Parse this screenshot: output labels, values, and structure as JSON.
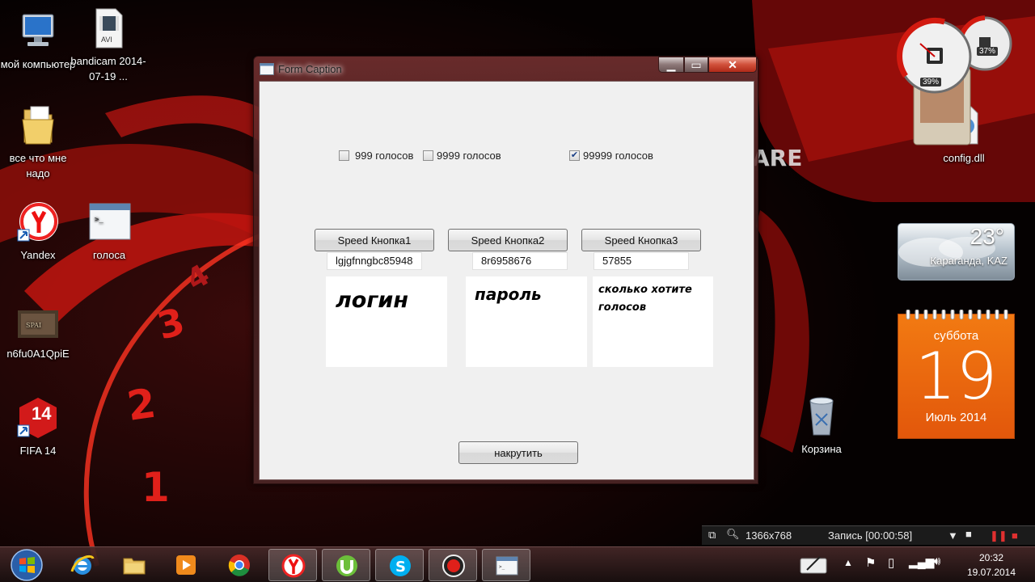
{
  "desktop": {
    "icons": [
      {
        "name": "my-computer",
        "label": "мой компьютер"
      },
      {
        "name": "bandicam-video",
        "label": "bandicam 2014-07-19 ..."
      },
      {
        "name": "folder",
        "label": "все что мне надо"
      },
      {
        "name": "yandex",
        "label": "Yandex"
      },
      {
        "name": "golosa",
        "label": "голоса"
      },
      {
        "name": "video-thumb",
        "label": "n6fu0A1QpiE"
      },
      {
        "name": "fifa14",
        "label": "FIFA 14"
      },
      {
        "name": "config-dll",
        "label": "config.dll"
      },
      {
        "name": "recycle-bin",
        "label": "Корзина"
      }
    ],
    "avi_badge": "AVI",
    "fifa_badge": "14"
  },
  "gadgets": {
    "cpu_percent": "39%",
    "memory_percent": "37%",
    "weather": {
      "temperature": "23°",
      "city": "Караганда, KAZ"
    },
    "calendar": {
      "weekday": "суббота",
      "day": "19",
      "month_year": "Июль 2014"
    }
  },
  "window": {
    "title": "Form Caption",
    "controls": {
      "minimize": "▁",
      "maximize": "▭",
      "close": "✕"
    },
    "checkboxes": [
      {
        "label": "999 голосов",
        "checked": false
      },
      {
        "label": "9999 голосов",
        "checked": false
      },
      {
        "label": "99999 голосов",
        "checked": true
      }
    ],
    "buttons": [
      "Speed Кнопка1",
      "Speed Кнопка2",
      "Speed Кнопка3"
    ],
    "fields": [
      "lgjgfnngbc85948",
      "8r6958676",
      "57855"
    ],
    "notes": [
      "логин",
      "пароль",
      "сколько хотите голосов"
    ],
    "action_label": "накрутить"
  },
  "bandicam_bar": {
    "resolution": "1366x768",
    "recording": "Запись [00:00:58]"
  },
  "taskbar": {
    "apps": [
      "internet-explorer",
      "file-explorer",
      "media-player",
      "chrome",
      "yandex",
      "utorrent",
      "skype",
      "bandicam",
      "app-window"
    ],
    "clock": {
      "time": "20:32",
      "date": "19.07.2014"
    }
  },
  "colors": {
    "accent_red": "#c8140f",
    "window_bg": "#f0f0f0",
    "calendar_orange": "#e8650e"
  }
}
